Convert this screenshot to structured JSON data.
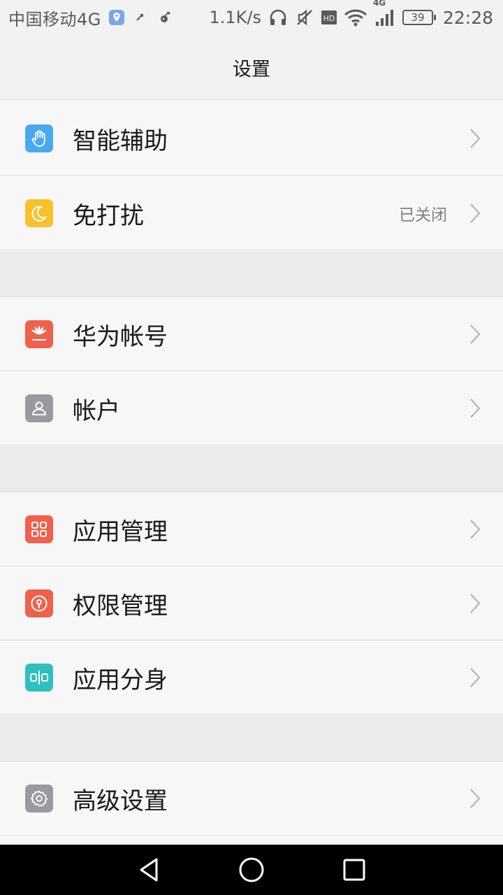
{
  "status_bar": {
    "carrier": "中国移动4G",
    "speed": "1.1K/s",
    "network_badge": "4G",
    "hd_badge": "HD",
    "battery": "39",
    "time": "22:28",
    "icons": [
      "location-icon",
      "usb-icon",
      "debug-icon",
      "headset-icon",
      "mute-icon",
      "hd-icon",
      "wifi-icon",
      "signal-icon",
      "battery-icon"
    ]
  },
  "header": {
    "title": "设置"
  },
  "items": [
    {
      "label": "智能辅助",
      "value": "",
      "icon": "hand-icon",
      "color": "#4aa8f0"
    },
    {
      "label": "免打扰",
      "value": "已关闭",
      "icon": "moon-icon",
      "color": "#f8c12c"
    },
    {
      "label": "华为帐号",
      "value": "",
      "icon": "huawei-logo-icon",
      "color": "#f0604b"
    },
    {
      "label": "帐户",
      "value": "",
      "icon": "user-icon",
      "color": "#9a9a9e"
    },
    {
      "label": "应用管理",
      "value": "",
      "icon": "apps-grid-icon",
      "color": "#f0604b"
    },
    {
      "label": "权限管理",
      "value": "",
      "icon": "keyhole-icon",
      "color": "#f0604b"
    },
    {
      "label": "应用分身",
      "value": "",
      "icon": "app-twin-icon",
      "color": "#2fbfbf"
    },
    {
      "label": "高级设置",
      "value": "",
      "icon": "gear-icon",
      "color": "#9a9a9e"
    }
  ],
  "nav": {
    "icons": [
      "back-icon",
      "home-icon",
      "recents-icon"
    ]
  }
}
